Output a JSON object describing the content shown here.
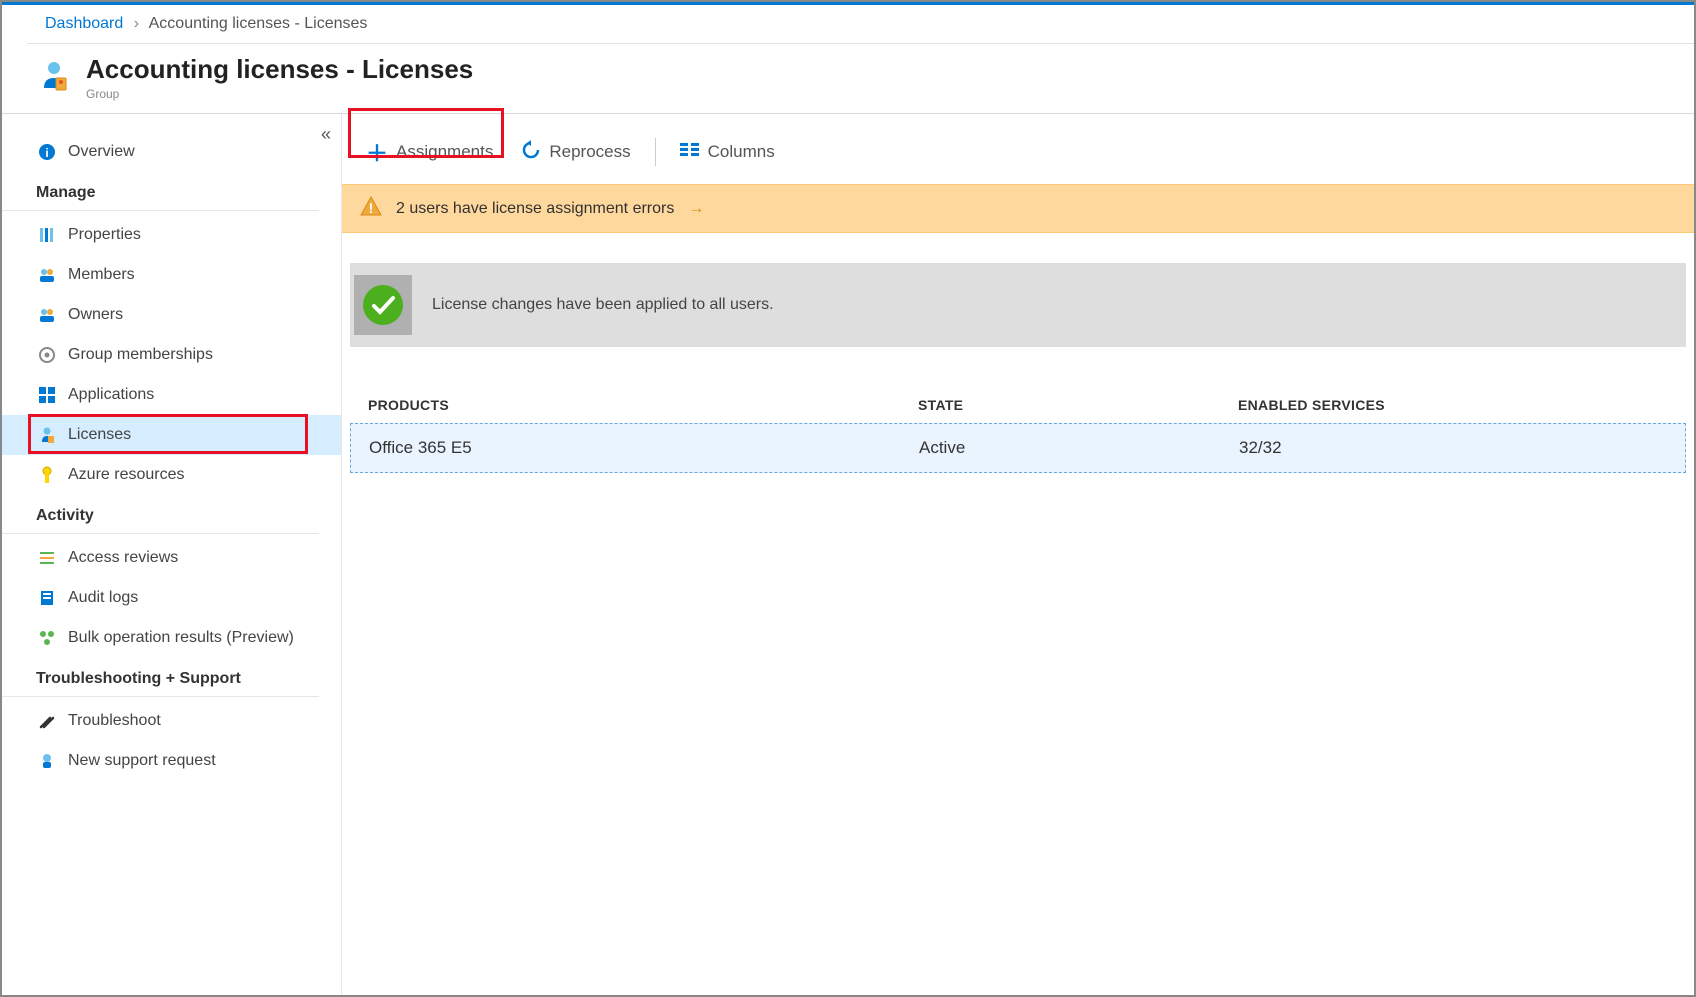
{
  "breadcrumb": {
    "root": "Dashboard",
    "current": "Accounting licenses - Licenses"
  },
  "header": {
    "title": "Accounting licenses - Licenses",
    "subtitle": "Group"
  },
  "sidebar": {
    "overview": "Overview",
    "manage": "Manage",
    "items_manage": {
      "properties": "Properties",
      "members": "Members",
      "owners": "Owners",
      "group_memberships": "Group memberships",
      "applications": "Applications",
      "licenses": "Licenses",
      "azure_resources": "Azure resources"
    },
    "activity": "Activity",
    "items_activity": {
      "access_reviews": "Access reviews",
      "audit_logs": "Audit logs",
      "bulk_ops": "Bulk operation results (Preview)"
    },
    "support": "Troubleshooting + Support",
    "items_support": {
      "troubleshoot": "Troubleshoot",
      "new_request": "New support request"
    }
  },
  "toolbar": {
    "assignments": "Assignments",
    "reprocess": "Reprocess",
    "columns": "Columns"
  },
  "warning": {
    "text": "2 users have license assignment errors"
  },
  "success": {
    "text": "License changes have been applied to all users."
  },
  "table": {
    "headers": {
      "products": "PRODUCTS",
      "state": "STATE",
      "services": "ENABLED SERVICES"
    },
    "rows": [
      {
        "product": "Office 365 E5",
        "state": "Active",
        "services": "32/32"
      }
    ]
  }
}
